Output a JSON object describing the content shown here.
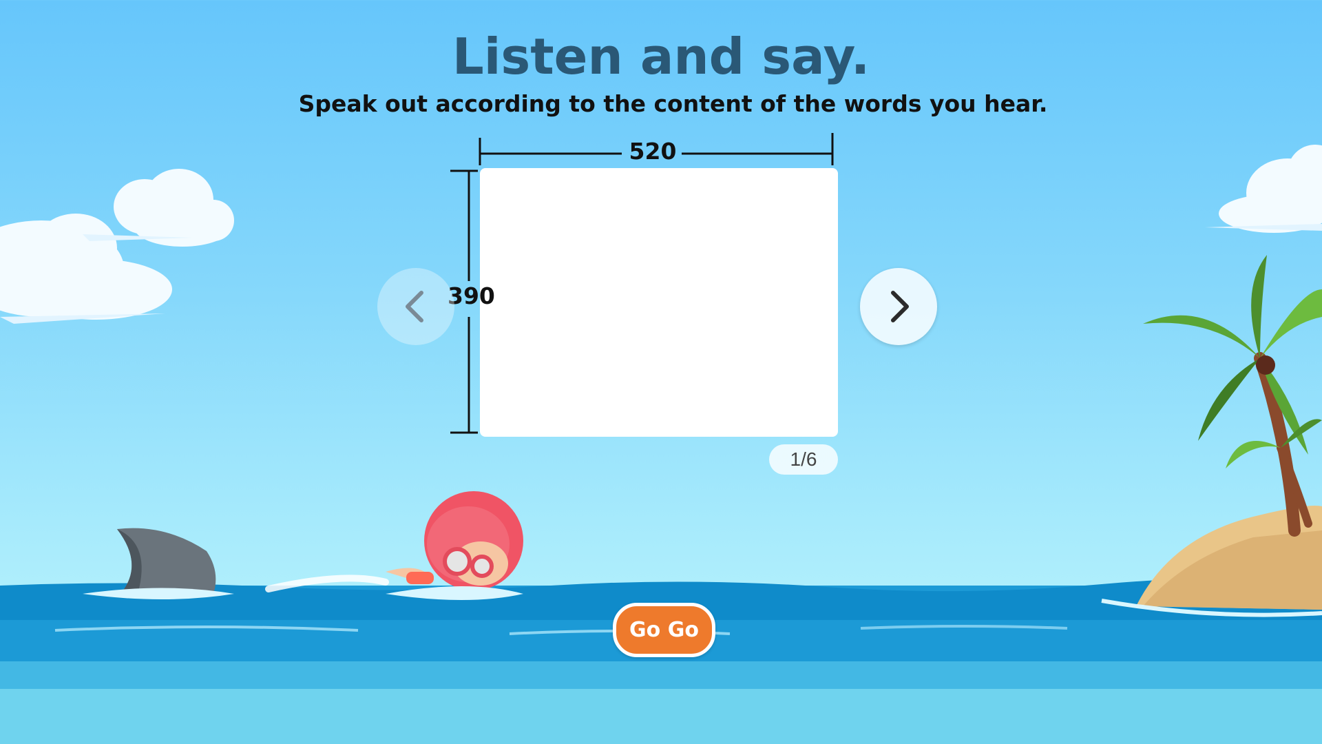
{
  "header": {
    "title": "Listen and say.",
    "subtitle": "Speak out according to the content of the words you hear."
  },
  "card": {
    "width_label": "520",
    "height_label": "390"
  },
  "navigation": {
    "prev_icon": "chevron-left-icon",
    "next_icon": "chevron-right-icon",
    "page_indicator": "1/6"
  },
  "actions": {
    "go_label": "Go Go"
  },
  "colors": {
    "title": "#2a5876",
    "go_button": "#ee7a2c",
    "sea": "#1c9ad6"
  }
}
